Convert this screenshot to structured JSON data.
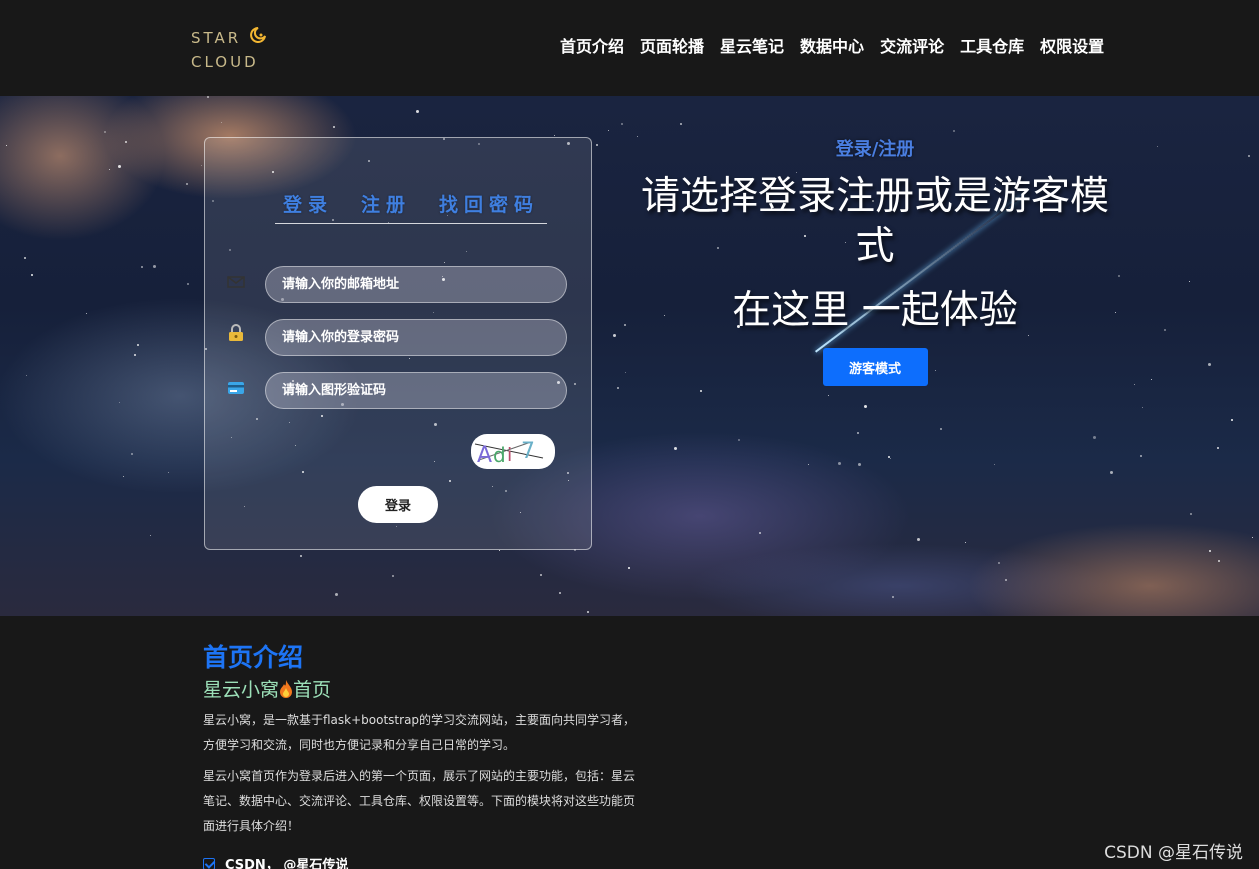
{
  "header": {
    "logo_line1": "STAR",
    "logo_line2": "CLOUD",
    "nav": [
      "首页介绍",
      "页面轮播",
      "星云笔记",
      "数据中心",
      "交流评论",
      "工具仓库",
      "权限设置"
    ]
  },
  "login": {
    "tabs": [
      "登录",
      "注册",
      "找回密码"
    ],
    "email_placeholder": "请输入你的邮箱地址",
    "password_placeholder": "请输入你的登录密码",
    "captcha_placeholder": "请输入图形验证码",
    "captcha_text": "Adi7",
    "submit_label": "登录"
  },
  "hero": {
    "kicker": "登录/注册",
    "title": "请选择登录注册或是游客模式",
    "subtitle": "在这里 一起体验",
    "guest_button": "游客模式"
  },
  "intro": {
    "heading": "首页介绍",
    "subheading_a": "星云小窝",
    "subheading_b": "首页",
    "paragraph1": "星云小窝，是一款基于flask+bootstrap的学习交流网站，主要面向共同学习者，方便学习和交流，同时也方便记录和分享自己日常的学习。",
    "paragraph2": "星云小窝首页作为登录后进入的第一个页面，展示了网站的主要功能，包括：星云笔记、数据中心、交流评论、工具仓库、权限设置等。下面的模块将对这些功能页面进行具体介绍！",
    "list_item": "CSDN，  @星石传说"
  },
  "watermark": "CSDN @星石传说",
  "colors": {
    "accent": "#0d6efd",
    "heading_blue": "#1d74f5",
    "subheading_green": "#9ce0b8",
    "tab_blue": "#3f7fe0",
    "logo_gold": "#c8b98a"
  },
  "icons": [
    "moon-icon",
    "mail-icon",
    "lock-icon",
    "card-icon",
    "flame-icon",
    "check-icon"
  ]
}
